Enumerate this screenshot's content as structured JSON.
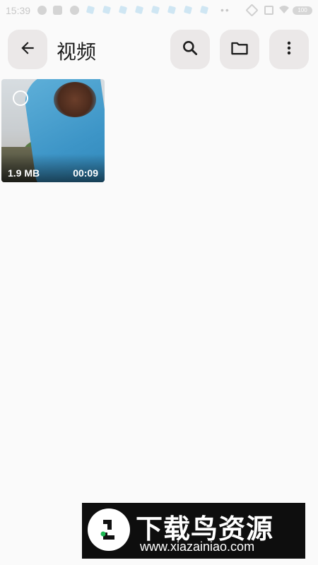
{
  "status_bar": {
    "time": "15:39",
    "dots": "••",
    "battery": "100"
  },
  "header": {
    "title": "视频"
  },
  "video": {
    "size": "1.9 MB",
    "duration": "00:09"
  },
  "watermark": {
    "title": "下载鸟资源",
    "url": "www.xiazainiao.com"
  },
  "colors": {
    "background": "#fafafa",
    "button_bg": "#ebe8e8",
    "watermark_bg": "#0e0e0e"
  },
  "icons": [
    "back-arrow-icon",
    "search-icon",
    "folder-icon",
    "more-vert-icon"
  ]
}
